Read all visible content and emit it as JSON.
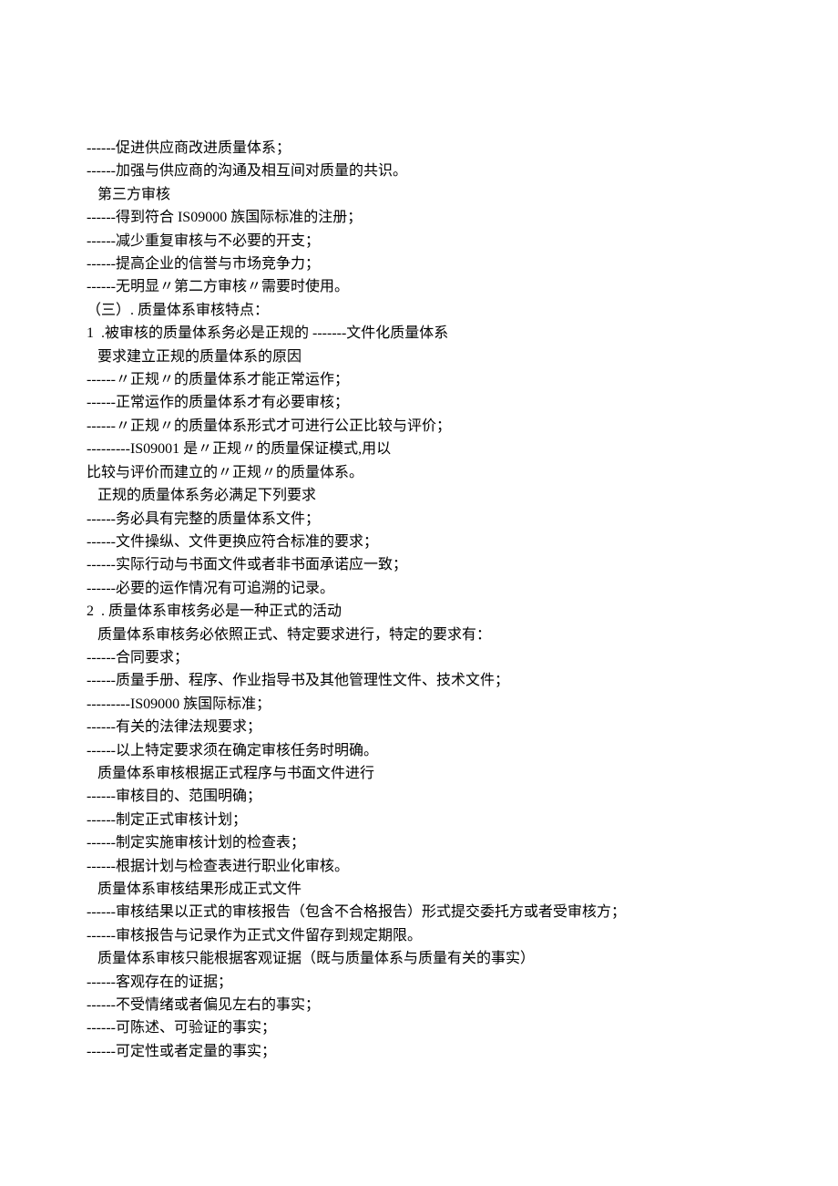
{
  "lines": [
    "------促进供应商改进质量体系；",
    "------加强与供应商的沟通及相互间对质量的共识。",
    "   第三方审核",
    "------得到符合 IS09000 族国际标准的注册；",
    "------减少重复审核与不必要的开支；",
    "------提高企业的信誉与市场竞争力；",
    "------无明显〃第二方审核〃需要时使用。",
    "（三）. 质量体系审核特点：",
    "1  .被审核的质量体系务必是正规的 -------文件化质量体系",
    "   要求建立正规的质量体系的原因",
    "------〃正规〃的质量体系才能正常运作；",
    "------正常运作的质量体系才有必要审核；",
    "------〃正规〃的质量体系形式才可进行公正比较与评价；",
    "---------IS09001 是〃正规〃的质量保证模式,用以",
    "比较与评价而建立的〃正规〃的质量体系。",
    "   正规的质量体系务必满足下列要求",
    "------务必具有完整的质量体系文件；",
    "------文件操纵、文件更换应符合标准的要求；",
    "------实际行动与书面文件或者非书面承诺应一致；",
    "------必要的运作情况有可追溯的记录。",
    "2  . 质量体系审核务必是一种正式的活动",
    "   质量体系审核务必依照正式、特定要求进行，特定的要求有：",
    "------合同要求；",
    "------质量手册、程序、作业指导书及其他管理性文件、技术文件；",
    "---------IS09000 族国际标准；",
    "------有关的法律法规要求；",
    "------以上特定要求须在确定审核任务时明确。",
    "   质量体系审核根据正式程序与书面文件进行",
    "------审核目的、范围明确；",
    "------制定正式审核计划；",
    "------制定实施审核计划的检查表；",
    "------根据计划与检查表进行职业化审核。",
    "   质量体系审核结果形成正式文件",
    "------审核结果以正式的审核报告（包含不合格报告）形式提交委托方或者受审核方；",
    "------审核报告与记录作为正式文件留存到规定期限。",
    "   质量体系审核只能根据客观证据（既与质量体系与质量有关的事实）",
    "------客观存在的证据；",
    "------不受情绪或者偏见左右的事实；",
    "------可陈述、可验证的事实；",
    "------可定性或者定量的事实；"
  ]
}
